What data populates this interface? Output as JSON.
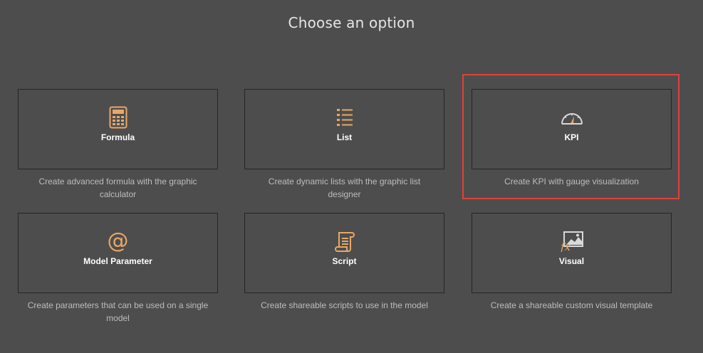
{
  "page_title": "Choose an option",
  "options": [
    {
      "label": "Formula",
      "icon": "calculator-icon",
      "description": "Create advanced formula with the graphic calculator"
    },
    {
      "label": "List",
      "icon": "list-icon",
      "description": "Create dynamic lists with the graphic list designer"
    },
    {
      "label": "KPI",
      "icon": "gauge-icon",
      "description": "Create KPI with gauge visualization"
    },
    {
      "label": "Model Parameter",
      "icon": "at-sign-icon",
      "description": "Create parameters that can be used on a single model"
    },
    {
      "label": "Script",
      "icon": "scroll-icon",
      "description": "Create shareable scripts to use in the model"
    },
    {
      "label": "Visual",
      "icon": "fx-image-icon",
      "description": "Create a shareable custom visual template"
    }
  ],
  "colors": {
    "background": "#4d4d4d",
    "icon_accent": "#e8a868",
    "highlight": "#e0413d"
  }
}
